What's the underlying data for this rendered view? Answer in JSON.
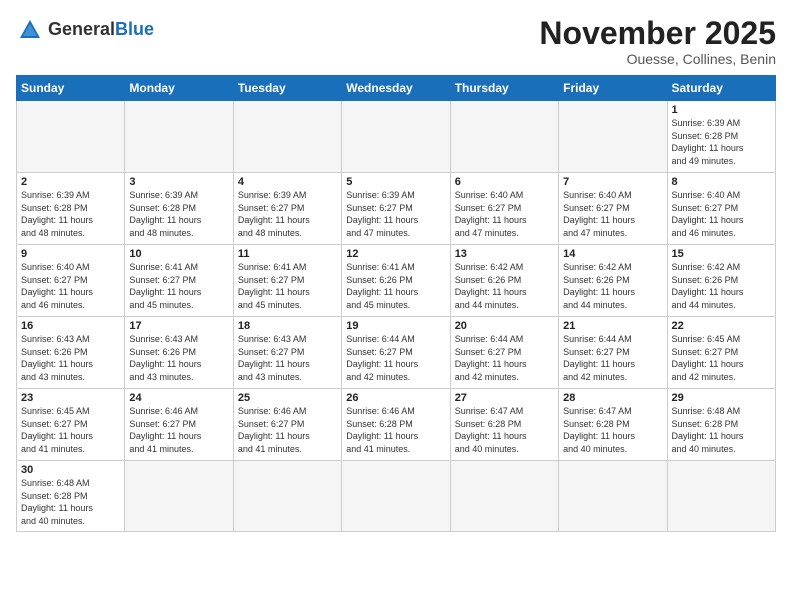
{
  "logo": {
    "text_general": "General",
    "text_blue": "Blue"
  },
  "header": {
    "month_year": "November 2025",
    "location": "Ouesse, Collines, Benin"
  },
  "weekdays": [
    "Sunday",
    "Monday",
    "Tuesday",
    "Wednesday",
    "Thursday",
    "Friday",
    "Saturday"
  ],
  "weeks": [
    [
      {
        "day": "",
        "info": ""
      },
      {
        "day": "",
        "info": ""
      },
      {
        "day": "",
        "info": ""
      },
      {
        "day": "",
        "info": ""
      },
      {
        "day": "",
        "info": ""
      },
      {
        "day": "",
        "info": ""
      },
      {
        "day": "1",
        "info": "Sunrise: 6:39 AM\nSunset: 6:28 PM\nDaylight: 11 hours\nand 49 minutes."
      }
    ],
    [
      {
        "day": "2",
        "info": "Sunrise: 6:39 AM\nSunset: 6:28 PM\nDaylight: 11 hours\nand 48 minutes."
      },
      {
        "day": "3",
        "info": "Sunrise: 6:39 AM\nSunset: 6:28 PM\nDaylight: 11 hours\nand 48 minutes."
      },
      {
        "day": "4",
        "info": "Sunrise: 6:39 AM\nSunset: 6:27 PM\nDaylight: 11 hours\nand 48 minutes."
      },
      {
        "day": "5",
        "info": "Sunrise: 6:39 AM\nSunset: 6:27 PM\nDaylight: 11 hours\nand 47 minutes."
      },
      {
        "day": "6",
        "info": "Sunrise: 6:40 AM\nSunset: 6:27 PM\nDaylight: 11 hours\nand 47 minutes."
      },
      {
        "day": "7",
        "info": "Sunrise: 6:40 AM\nSunset: 6:27 PM\nDaylight: 11 hours\nand 47 minutes."
      },
      {
        "day": "8",
        "info": "Sunrise: 6:40 AM\nSunset: 6:27 PM\nDaylight: 11 hours\nand 46 minutes."
      }
    ],
    [
      {
        "day": "9",
        "info": "Sunrise: 6:40 AM\nSunset: 6:27 PM\nDaylight: 11 hours\nand 46 minutes."
      },
      {
        "day": "10",
        "info": "Sunrise: 6:41 AM\nSunset: 6:27 PM\nDaylight: 11 hours\nand 45 minutes."
      },
      {
        "day": "11",
        "info": "Sunrise: 6:41 AM\nSunset: 6:27 PM\nDaylight: 11 hours\nand 45 minutes."
      },
      {
        "day": "12",
        "info": "Sunrise: 6:41 AM\nSunset: 6:26 PM\nDaylight: 11 hours\nand 45 minutes."
      },
      {
        "day": "13",
        "info": "Sunrise: 6:42 AM\nSunset: 6:26 PM\nDaylight: 11 hours\nand 44 minutes."
      },
      {
        "day": "14",
        "info": "Sunrise: 6:42 AM\nSunset: 6:26 PM\nDaylight: 11 hours\nand 44 minutes."
      },
      {
        "day": "15",
        "info": "Sunrise: 6:42 AM\nSunset: 6:26 PM\nDaylight: 11 hours\nand 44 minutes."
      }
    ],
    [
      {
        "day": "16",
        "info": "Sunrise: 6:43 AM\nSunset: 6:26 PM\nDaylight: 11 hours\nand 43 minutes."
      },
      {
        "day": "17",
        "info": "Sunrise: 6:43 AM\nSunset: 6:26 PM\nDaylight: 11 hours\nand 43 minutes."
      },
      {
        "day": "18",
        "info": "Sunrise: 6:43 AM\nSunset: 6:27 PM\nDaylight: 11 hours\nand 43 minutes."
      },
      {
        "day": "19",
        "info": "Sunrise: 6:44 AM\nSunset: 6:27 PM\nDaylight: 11 hours\nand 42 minutes."
      },
      {
        "day": "20",
        "info": "Sunrise: 6:44 AM\nSunset: 6:27 PM\nDaylight: 11 hours\nand 42 minutes."
      },
      {
        "day": "21",
        "info": "Sunrise: 6:44 AM\nSunset: 6:27 PM\nDaylight: 11 hours\nand 42 minutes."
      },
      {
        "day": "22",
        "info": "Sunrise: 6:45 AM\nSunset: 6:27 PM\nDaylight: 11 hours\nand 42 minutes."
      }
    ],
    [
      {
        "day": "23",
        "info": "Sunrise: 6:45 AM\nSunset: 6:27 PM\nDaylight: 11 hours\nand 41 minutes."
      },
      {
        "day": "24",
        "info": "Sunrise: 6:46 AM\nSunset: 6:27 PM\nDaylight: 11 hours\nand 41 minutes."
      },
      {
        "day": "25",
        "info": "Sunrise: 6:46 AM\nSunset: 6:27 PM\nDaylight: 11 hours\nand 41 minutes."
      },
      {
        "day": "26",
        "info": "Sunrise: 6:46 AM\nSunset: 6:28 PM\nDaylight: 11 hours\nand 41 minutes."
      },
      {
        "day": "27",
        "info": "Sunrise: 6:47 AM\nSunset: 6:28 PM\nDaylight: 11 hours\nand 40 minutes."
      },
      {
        "day": "28",
        "info": "Sunrise: 6:47 AM\nSunset: 6:28 PM\nDaylight: 11 hours\nand 40 minutes."
      },
      {
        "day": "29",
        "info": "Sunrise: 6:48 AM\nSunset: 6:28 PM\nDaylight: 11 hours\nand 40 minutes."
      }
    ],
    [
      {
        "day": "30",
        "info": "Sunrise: 6:48 AM\nSunset: 6:28 PM\nDaylight: 11 hours\nand 40 minutes."
      },
      {
        "day": "",
        "info": ""
      },
      {
        "day": "",
        "info": ""
      },
      {
        "day": "",
        "info": ""
      },
      {
        "day": "",
        "info": ""
      },
      {
        "day": "",
        "info": ""
      },
      {
        "day": "",
        "info": ""
      }
    ]
  ]
}
